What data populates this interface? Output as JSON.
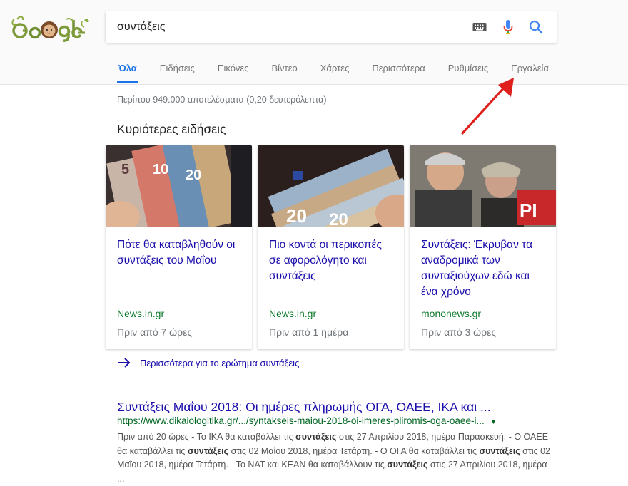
{
  "search": {
    "query": "συντάξεις"
  },
  "tabs": [
    "Όλα",
    "Ειδήσεις",
    "Εικόνες",
    "Βίντεο",
    "Χάρτες",
    "Περισσότερα",
    "Ρυθμίσεις",
    "Εργαλεία"
  ],
  "stats": "Περίπου 949.000 αποτελέσματα (0,20 δευτερόλεπτα)",
  "news": {
    "heading": "Κυριότερες ειδήσεις",
    "cards": [
      {
        "title": "Πότε θα καταβληθούν οι συντάξεις του Μαΐου",
        "source": "News.in.gr",
        "time": "Πριν από 7 ώρες"
      },
      {
        "title": "Πιο κοντά οι περικοπές σε αφορολόγητο και συντάξεις",
        "source": "News.in.gr",
        "time": "Πριν από 1 ημέρα"
      },
      {
        "title": "Συντάξεις: Έκρυβαν τα αναδρομικά των συνταξιούχων εδώ και ένα χρόνο",
        "source": "mononews.gr",
        "time": "Πριν από 3 ώρες"
      }
    ],
    "more_label": "Περισσότερα για το ερώτημα συντάξεις"
  },
  "result": {
    "title": "Συντάξεις Μαΐου 2018: Οι ημέρες πληρωμής ΟΓΑ, ΟΑΕΕ, ΙΚΑ και ...",
    "url": "https://www.dikaiologitika.gr/.../syntakseis-maiou-2018-oi-imeres-pliromis-oga-oaee-i...",
    "snippet": [
      {
        "t": "Πριν από 20 ώρες - Το ΙΚΑ θα καταβάλλει τις "
      },
      {
        "b": "συντάξεις"
      },
      {
        "t": " στις 27 Απριλίου 2018, ημέρα Παρασκευή. - Ο ΟΑΕΕ θα καταβάλλει τις "
      },
      {
        "b": "συντάξεις"
      },
      {
        "t": " στις 02 Μαΐου 2018, ημέρα Τετάρτη. - Ο ΟΓΑ θα καταβάλλει τις "
      },
      {
        "b": "συντάξεις"
      },
      {
        "t": " στις 02 Μαΐου 2018, ημέρα Τετάρτη. - Το ΝΑΤ και ΚΕΑΝ θα καταβάλλουν τις "
      },
      {
        "b": "συντάξεις"
      },
      {
        "t": " στις 27 Απριλίου 2018, ημέρα ..."
      }
    ]
  },
  "colors": {
    "accent": "#1a73e8",
    "link": "#1a0dab",
    "url_green": "#006621",
    "source_green": "#0e7a2c",
    "annotation_red": "#e0201c"
  },
  "icons": [
    "keyboard-icon",
    "microphone-icon",
    "search-icon",
    "arrow-right-icon",
    "caret-down-icon"
  ]
}
